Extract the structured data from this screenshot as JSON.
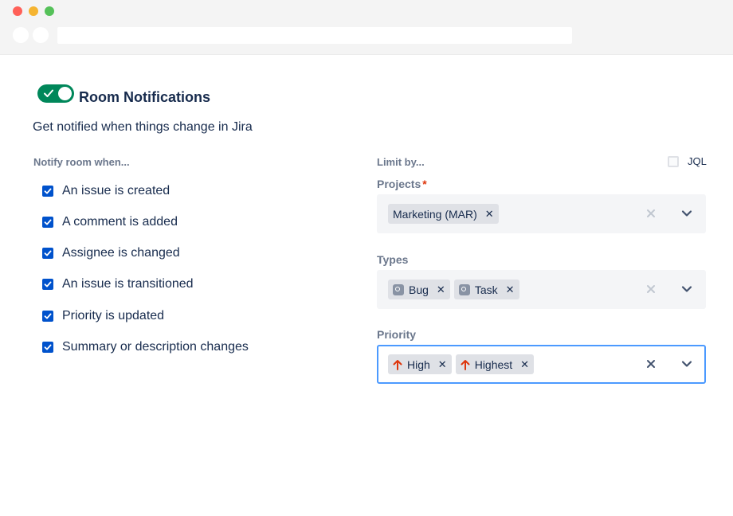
{
  "header": {
    "title": "Room Notifications",
    "subtitle": "Get notified when things change in Jira",
    "toggle_on": true
  },
  "notify": {
    "label": "Notify room when...",
    "items": [
      {
        "label": "An issue is created",
        "checked": true
      },
      {
        "label": "A comment is added",
        "checked": true
      },
      {
        "label": "Assignee is changed",
        "checked": true
      },
      {
        "label": "An issue is transitioned",
        "checked": true
      },
      {
        "label": "Priority is updated",
        "checked": true
      },
      {
        "label": "Summary or description changes",
        "checked": true
      }
    ]
  },
  "limit": {
    "label": "Limit by...",
    "jql_label": "JQL",
    "jql_checked": false
  },
  "projects": {
    "label": "Projects",
    "required_mark": "*",
    "tags": [
      "Marketing (MAR)"
    ]
  },
  "types": {
    "label": "Types",
    "tags": [
      "Bug",
      "Task"
    ]
  },
  "priority": {
    "label": "Priority",
    "tags": [
      "High",
      "Highest"
    ]
  },
  "colors": {
    "toggle_on": "#00875a",
    "checkbox": "#0052cc",
    "focus_border": "#4c9aff",
    "priority_arrow": "#de350b"
  }
}
